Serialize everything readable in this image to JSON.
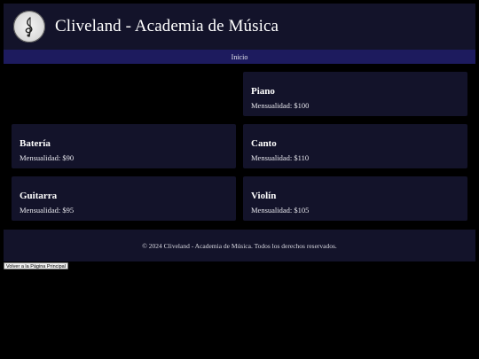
{
  "header": {
    "title": "Cliveland - Academia de Música",
    "logo_icon": "treble-clef-icon"
  },
  "nav": {
    "items": [
      {
        "label": "Inicio"
      }
    ]
  },
  "courses": [
    {
      "name": "Piano",
      "price": "Mensualidad: $100"
    },
    {
      "name": "Batería",
      "price": "Mensualidad: $90"
    },
    {
      "name": "Canto",
      "price": "Mensualidad: $110"
    },
    {
      "name": "Guitarra",
      "price": "Mensualidad: $95"
    },
    {
      "name": "Violín",
      "price": "Mensualidad: $105"
    }
  ],
  "footer": {
    "copyright": "© 2024 Cliveland - Academia de Música. Todos los derechos reservados."
  },
  "back_button": {
    "label": "Volver a la Página Principal"
  },
  "colors": {
    "background": "#000000",
    "panel": "#13132a",
    "nav": "#1d1b5e"
  }
}
